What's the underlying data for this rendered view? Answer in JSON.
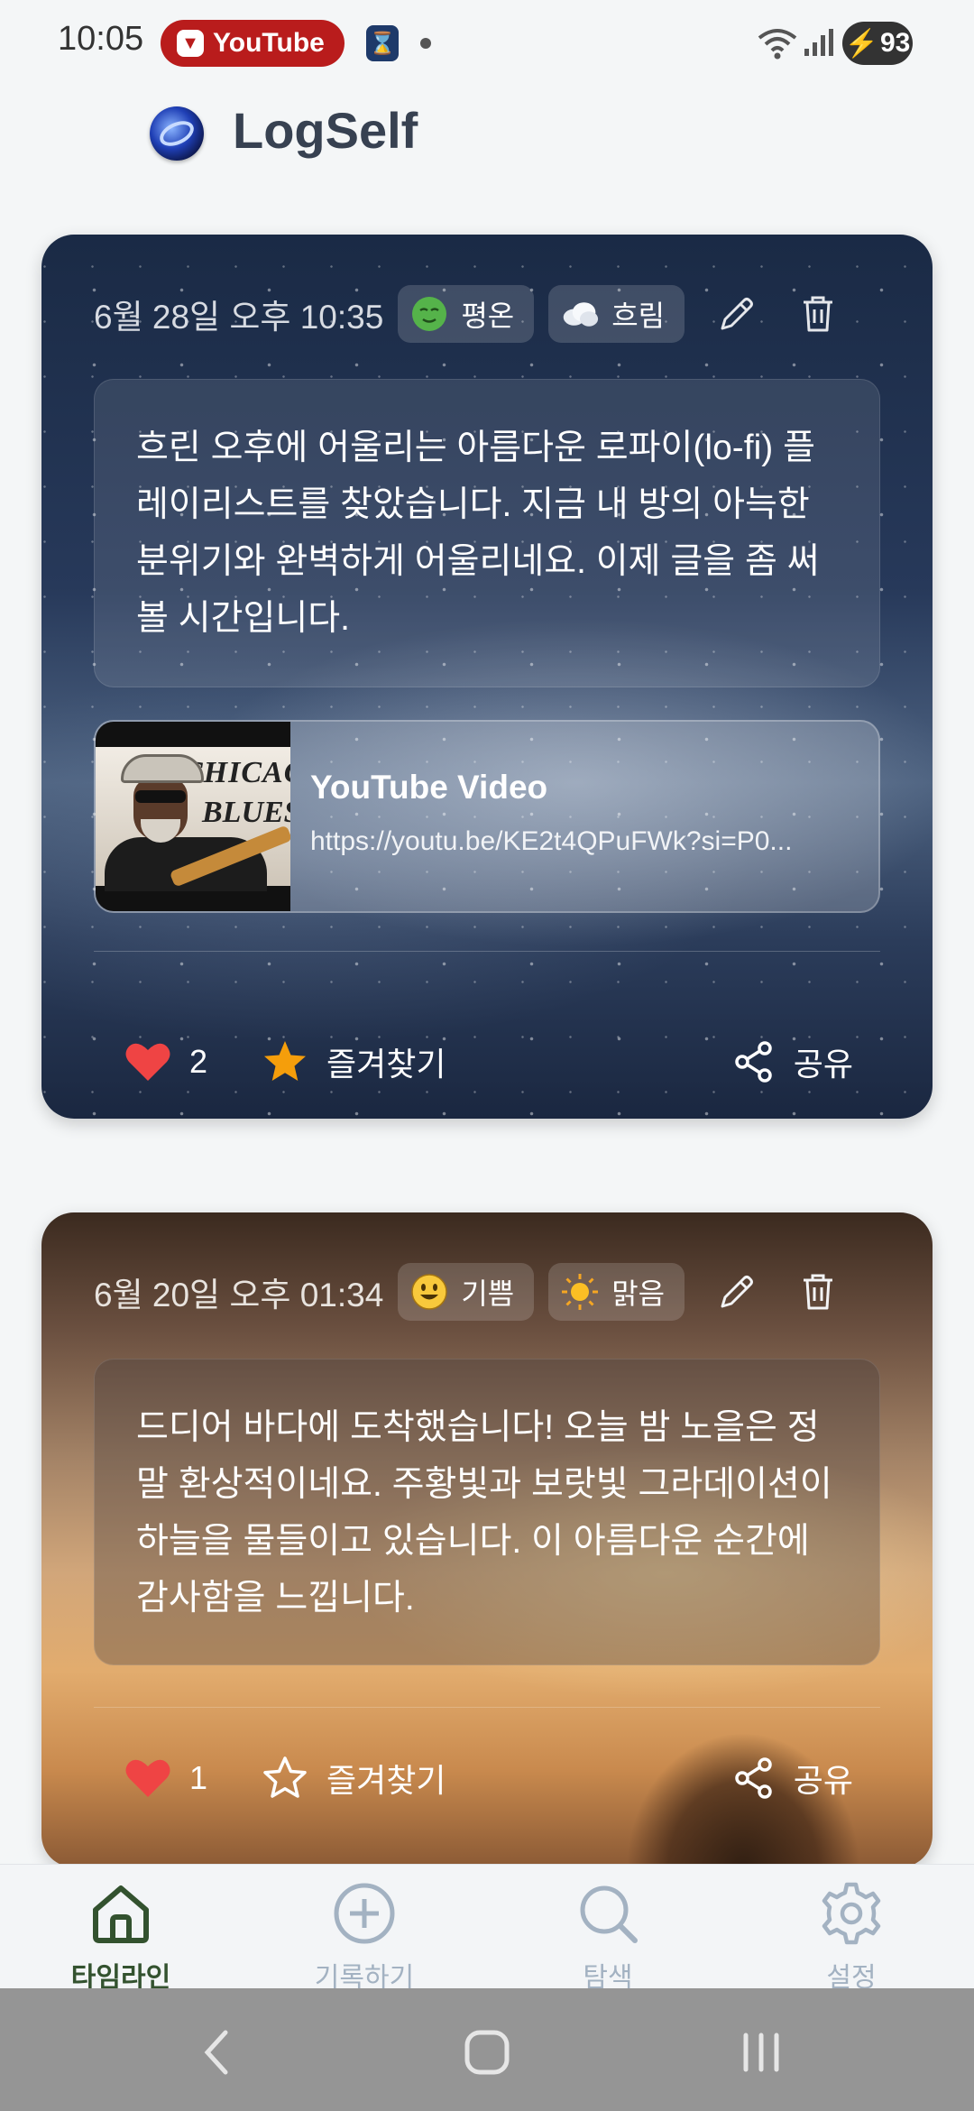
{
  "status_bar": {
    "time": "10:05",
    "app_chip": "YouTube",
    "battery": "93"
  },
  "header": {
    "title": "LogSelf"
  },
  "entries": [
    {
      "date": "6월 28일 오후 10:35",
      "mood": {
        "label": "평온",
        "icon": "relieved-face-icon"
      },
      "weather": {
        "label": "흐림",
        "icon": "cloud-icon"
      },
      "text": "흐린 오후에 어울리는 아름다운 로파이(lo-fi) 플레이리스트를 찾았습니다. 지금 내 방의 아늑한 분위기와 완벽하게 어울리네요. 이제 글을 좀 써볼 시간입니다.",
      "link": {
        "title": "YouTube Video",
        "url": "https://youtu.be/KE2t4QPuFWk?si=P0...",
        "thumbnail_text": [
          "CHICAG",
          "BLUES"
        ]
      },
      "likes": "2",
      "favorite_label": "즐겨찾기",
      "favorite_active": true,
      "share_label": "공유"
    },
    {
      "date": "6월 20일 오후 01:34",
      "mood": {
        "label": "기쁨",
        "icon": "smiling-face-icon"
      },
      "weather": {
        "label": "맑음",
        "icon": "sun-icon"
      },
      "text": "드디어 바다에 도착했습니다! 오늘 밤 노을은 정말 환상적이네요. 주황빛과 보랏빛 그라데이션이 하늘을 물들이고 있습니다. 이 아름다운 순간에 감사함을 느낍니다.",
      "likes": "1",
      "favorite_label": "즐겨찾기",
      "favorite_active": false,
      "share_label": "공유"
    }
  ],
  "bottom_nav": [
    {
      "label": "타임라인",
      "icon": "home-icon",
      "active": true
    },
    {
      "label": "기록하기",
      "icon": "add-circle-icon",
      "active": false
    },
    {
      "label": "탐색",
      "icon": "search-icon",
      "active": false
    },
    {
      "label": "설정",
      "icon": "gear-icon",
      "active": false
    }
  ],
  "colors": {
    "like": "#ef4444",
    "favorite_active": "#f59e0b",
    "nav_active": "#33522f",
    "nav_inactive": "#a3b2c2"
  }
}
